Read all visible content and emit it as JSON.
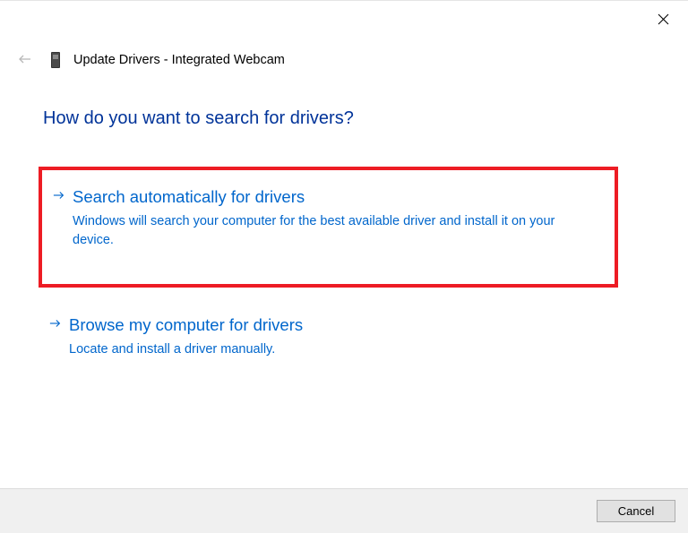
{
  "window": {
    "title": "Update Drivers - Integrated Webcam"
  },
  "heading": "How do you want to search for drivers?",
  "options": [
    {
      "title": "Search automatically for drivers",
      "description": "Windows will search your computer for the best available driver and install it on your device.",
      "highlighted": true
    },
    {
      "title": "Browse my computer for drivers",
      "description": "Locate and install a driver manually.",
      "highlighted": false
    }
  ],
  "buttons": {
    "cancel": "Cancel"
  }
}
